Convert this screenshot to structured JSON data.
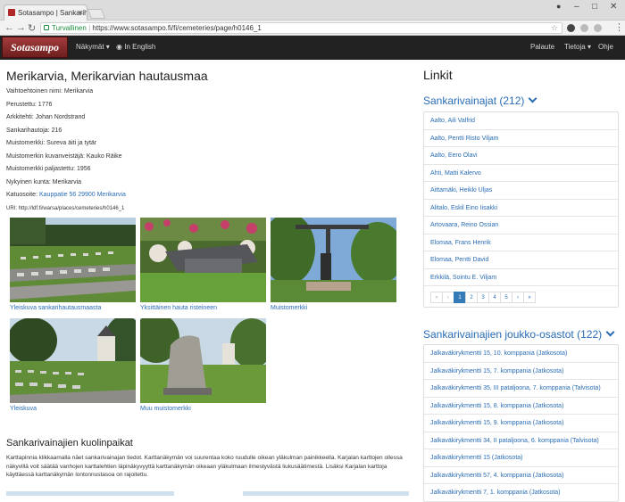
{
  "browser": {
    "tab_title": "Sotasampo | Sankarihaut",
    "secure_label": "Turvallinen",
    "url": "https://www.sotasampo.fi/fi/cemeteries/page/h0146_1"
  },
  "navbar": {
    "logo": "Sotasampo",
    "views": "Näkymät",
    "english": "In English",
    "feedback": "Palaute",
    "info": "Tietoja",
    "help": "Ohje"
  },
  "cemetery": {
    "title": "Merikarvia, Merikarvian hautausmaa",
    "facts": [
      "Vaihtoehtoinen nimi: Merikarvia",
      "Perustettu: 1776",
      "Arkkitehti: Johan Nordstrand",
      "Sankarihautoja: 216",
      "Muistomerkki: Sureva äiti ja tytär",
      "Muistomerkin kuvanveistäjä: Kauko Räike",
      "Muistomerkki paljastettu: 1956",
      "Nykyinen kunta: Merikarvia"
    ],
    "address_label": "Katuosoite:",
    "address_value": "Kauppatie 56 29900 Merikarvia",
    "uri": "URI: http://ldf.fi/warsa/places/cemeteries/h0146_1",
    "photos": [
      "Yleiskuva sankarihautausmaasta",
      "Yksittäinen hauta risteineen",
      "Muistomerkki",
      "Yleiskuva",
      "Muu muistomerkki"
    ],
    "deaths_heading": "Sankarivainajien kuolinpaikat",
    "deaths_text": "Karttapinnia klikkaamalla näet sankarivainajan tiedot. Karttanäkymän voi suurentaa koko ruudulle oikean yläkulman painikkeella. Karjalan karttojen ollessa näkyvillä voit säätää vanhojen karttalehtien läpinäkyvyyttä karttanäkymän oikeaan yläkulmaan ilmestyvästä liukusäätimestä. Lisäksi Karjalan karttoja käyttäessä karttanäkymän lontonnustasoa on rajoitettu."
  },
  "sidebar": {
    "heading": "Linkit",
    "heroes": {
      "title": "Sankarivainajat (212)",
      "items": [
        "Aalto, Aili Valfrid",
        "Aalto, Pentti Risto Viljam",
        "Aalto, Eero Olavi",
        "Ahti, Matti Kalervo",
        "Aittamäki, Heikki Uljas",
        "Alitalo, Eskil Eino Iisakki",
        "Artovaara, Reino Ossian",
        "Elomaa, Frans Henrik",
        "Elomaa, Pentti David",
        "Erkkilä, Sointu E. Viljam"
      ],
      "pager": [
        "«",
        "‹",
        "1",
        "2",
        "3",
        "4",
        "5",
        "›",
        "»"
      ]
    },
    "units": {
      "title": "Sankarivainajien joukko-osastot (122)",
      "items": [
        "Jalkaväkirykmentti 15, 10. komppania (Jatkosota)",
        "Jalkaväkirykmentti 15, 7. komppania (Jatkosota)",
        "Jalkaväkirykmentti 35, III pataljoona, 7. komppania (Talvisota)",
        "Jalkaväkirykmentti 15, 8. komppania (Jatkosota)",
        "Jalkaväkirykmentti 15, 9. komppania (Jatkosota)",
        "Jalkaväkirykmentti 34, II pataljoona, 6. komppania (Talvisota)",
        "Jalkaväkirykmentti 15 (Jatkosota)",
        "Jalkaväkirykmentti 57, 4. komppania (Jatkosota)",
        "Jalkaväkirykmentti 7, 1. komppania (Jatkosota)"
      ]
    }
  }
}
